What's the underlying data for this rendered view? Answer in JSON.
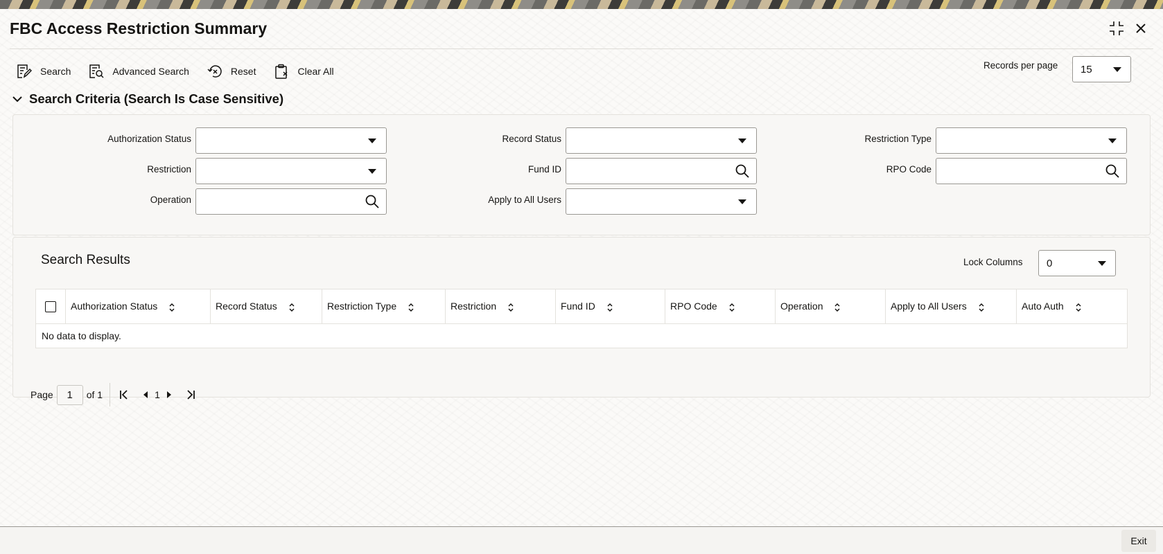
{
  "window": {
    "title": "FBC Access Restriction Summary"
  },
  "toolbar": {
    "search": "Search",
    "advanced_search": "Advanced Search",
    "reset": "Reset",
    "clear_all": "Clear All"
  },
  "records_per_page": {
    "label": "Records per page",
    "value": "15"
  },
  "search_criteria": {
    "header": "Search Criteria (Search Is Case Sensitive)",
    "fields": {
      "authorization_status": {
        "label": "Authorization Status",
        "value": ""
      },
      "record_status": {
        "label": "Record Status",
        "value": ""
      },
      "restriction_type": {
        "label": "Restriction Type",
        "value": ""
      },
      "restriction": {
        "label": "Restriction",
        "value": ""
      },
      "fund_id": {
        "label": "Fund ID",
        "value": ""
      },
      "rpo_code": {
        "label": "RPO Code",
        "value": ""
      },
      "operation": {
        "label": "Operation",
        "value": ""
      },
      "apply_to_all_users": {
        "label": "Apply to All Users",
        "value": ""
      }
    }
  },
  "results": {
    "title": "Search Results",
    "lock_columns": {
      "label": "Lock Columns",
      "value": "0"
    },
    "columns": [
      "Authorization Status",
      "Record Status",
      "Restriction Type",
      "Restriction",
      "Fund ID",
      "RPO Code",
      "Operation",
      "Apply to All Users",
      "Auto Auth"
    ],
    "empty_message": "No data to display."
  },
  "pagination": {
    "page_label": "Page",
    "current": "1",
    "of_label": "of 1",
    "page_number": "1"
  },
  "footer": {
    "exit": "Exit"
  }
}
